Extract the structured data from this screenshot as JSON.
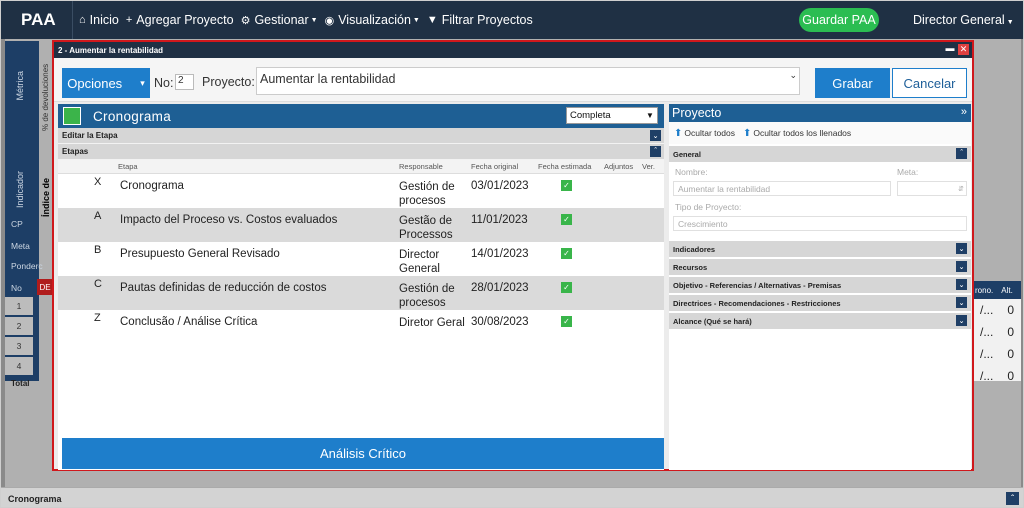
{
  "nav": {
    "brand": "PAA",
    "items": [
      {
        "label": "Inicio",
        "icon": "home-icon"
      },
      {
        "label": "Agregar Proyecto",
        "icon": "plus-icon"
      },
      {
        "label": "Gestionar",
        "icon": "cogs-icon"
      },
      {
        "label": "Visualización",
        "icon": "eye-icon"
      },
      {
        "label": "Filtrar Proyectos",
        "icon": "filter-icon"
      }
    ],
    "save_label": "Guardar PAA",
    "user_label": "Director General",
    "colors": {
      "bar": "#1f3044",
      "save": "#2bbd52"
    }
  },
  "background": {
    "metric_label": "Métrica",
    "indicator_label": "Indicador",
    "devoluciones_label": "% de devoluciones",
    "indice_label": "Índice de",
    "tabs": [
      "CP",
      "Meta",
      "Ponderc",
      "No"
    ],
    "rows": [
      "1",
      "2",
      "3",
      "4"
    ],
    "de_label": "DE",
    "total_label": "Total",
    "right_headers": [
      "rono.",
      "Alt."
    ],
    "right_values": [
      "0",
      "0",
      "0",
      "0"
    ],
    "footer_label": "Cronograma"
  },
  "modal": {
    "title": "2 - Aumentar la rentabilidad",
    "options_label": "Opciones",
    "no_label": "No:",
    "no_value": "2",
    "project_label": "Proyecto:",
    "project_value": "Aumentar la rentabilidad",
    "save_label": "Grabar",
    "cancel_label": "Cancelar",
    "accent": "#1e7ecb"
  },
  "cronograma": {
    "title": "Cronograma",
    "filter_value": "Completa",
    "edit_section": "Editar la Etapa",
    "stages_section": "Etapas",
    "columns": [
      "Etapa",
      "Responsable",
      "Fecha original",
      "Fecha estimada",
      "Adjuntos",
      "Ver."
    ],
    "rows": [
      {
        "code": "X",
        "stage": "Cronograma",
        "resp": "Gestión de procesos",
        "date": "03/01/2023"
      },
      {
        "code": "A",
        "stage": "Impacto del Proceso vs. Costos evaluados",
        "resp": "Gestão de Processos",
        "date": "11/01/2023"
      },
      {
        "code": "B",
        "stage": "Presupuesto General Revisado",
        "resp": "Director General",
        "date": "14/01/2023"
      },
      {
        "code": "C",
        "stage": "Pautas definidas de reducción de costos",
        "resp": "Gestión de procesos",
        "date": "28/01/2023"
      },
      {
        "code": "Z",
        "stage": "Conclusão / Análise Crítica",
        "resp": "Diretor Geral",
        "date": "30/08/2023"
      }
    ],
    "analysis_label": "Análisis Crítico"
  },
  "project_panel": {
    "title": "Proyecto",
    "hide_all": "Ocultar todos",
    "hide_filled": "Ocultar todos los llenados",
    "general_label": "General",
    "name_label": "Nombre:",
    "name_value": "Aumentar la rentabilidad",
    "goal_label": "Meta:",
    "type_label": "Tipo de Proyecto:",
    "type_value": "Crescimiento",
    "sections": [
      "Indicadores",
      "Recursos",
      "Objetivo - Referencias / Alternativas - Premisas",
      "Directrices - Recomendaciones - Restricciones",
      "Alcance (Qué se hará)"
    ]
  }
}
